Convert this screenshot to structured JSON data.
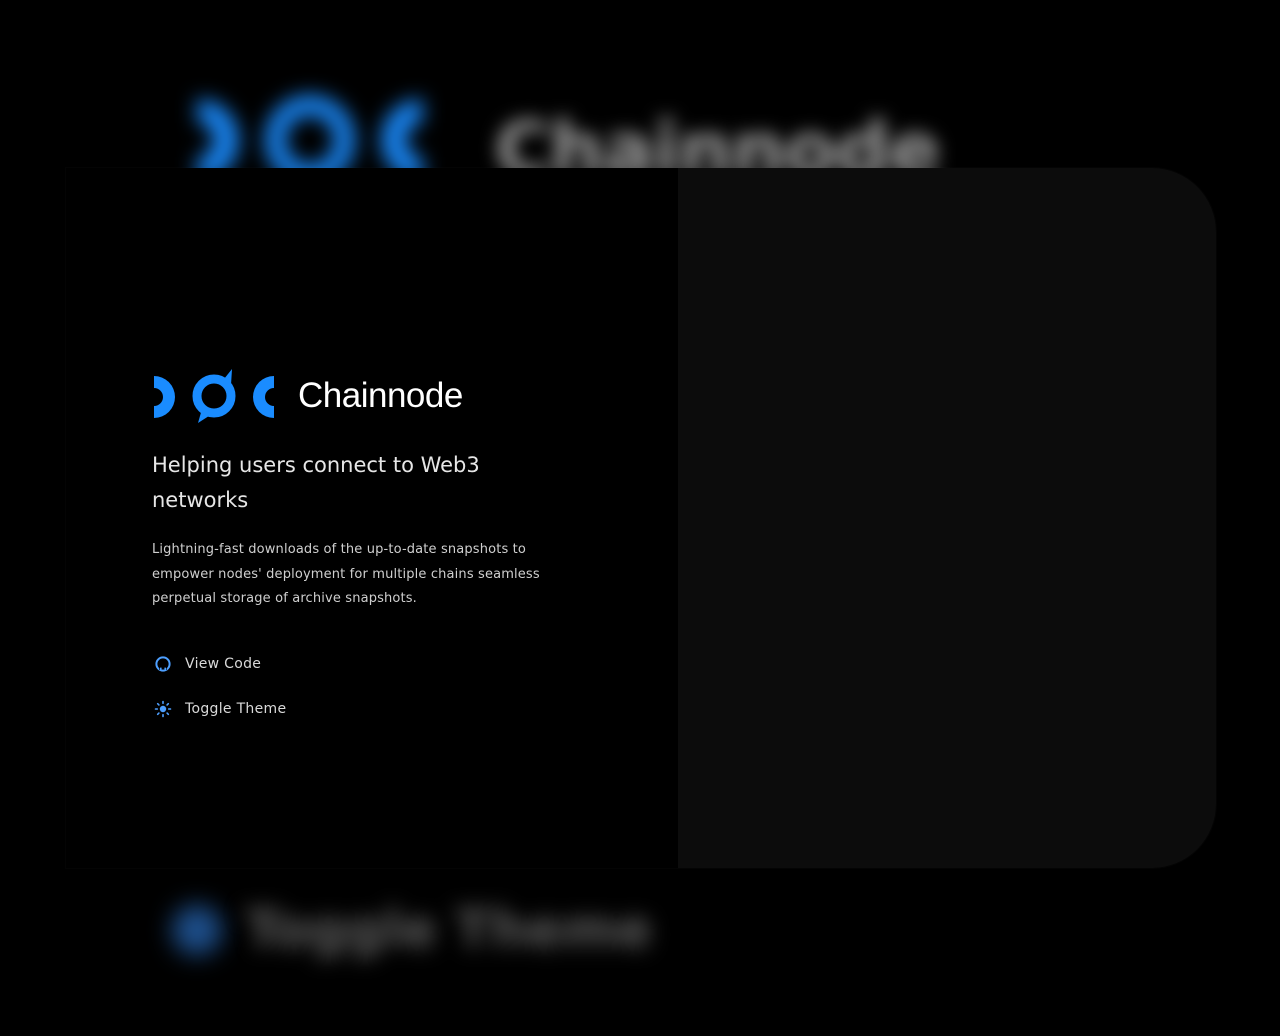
{
  "brand": {
    "name": "Chainnode",
    "accent_color": "#1a8cff"
  },
  "hero": {
    "tagline": "Helping users connect to Web3 networks",
    "description": "Lightning-fast downloads of the up-to-date snapshots to empower nodes' deployment for multiple chains seamless perpetual storage of archive snapshots."
  },
  "actions": [
    {
      "label": "View Code",
      "icon": "github-icon"
    },
    {
      "label": "Toggle Theme",
      "icon": "sun-icon"
    }
  ],
  "background": {
    "brand_name": "Chainnode",
    "theme_label": "Toggle Theme"
  }
}
